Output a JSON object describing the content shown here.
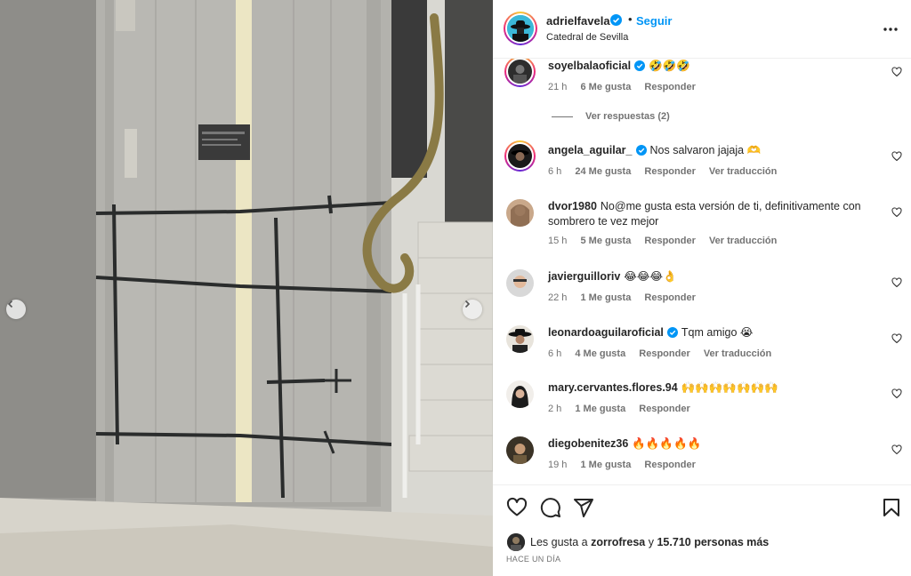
{
  "post": {
    "author": "adrielfavela",
    "follow_label": "Seguir",
    "dot": "•",
    "location": "Catedral de Sevilla",
    "more_icon": "more-horizontal-icon"
  },
  "comments": [
    {
      "user": "soyelbalaoficial",
      "verified": true,
      "text": "🤣🤣🤣",
      "time": "21 h",
      "likes": "6 Me gusta",
      "reply": "Responder",
      "translate": "",
      "view_replies": "Ver respuestas (2)"
    },
    {
      "user": "angela_aguilar_",
      "verified": true,
      "text": "Nos salvaron jajaja 🫶",
      "time": "6 h",
      "likes": "24 Me gusta",
      "reply": "Responder",
      "translate": "Ver traducción"
    },
    {
      "user": "dvor1980",
      "verified": false,
      "text": "No@me gusta esta versión de ti, definitivamente con sombrero te vez mejor",
      "time": "15 h",
      "likes": "5 Me gusta",
      "reply": "Responder",
      "translate": "Ver traducción"
    },
    {
      "user": "javierguilloriv",
      "verified": false,
      "text": "😂😂😂👌",
      "time": "22 h",
      "likes": "1 Me gusta",
      "reply": "Responder",
      "translate": ""
    },
    {
      "user": "leonardoaguilaroficial",
      "verified": true,
      "text": "Tqm amigo 😭",
      "time": "6 h",
      "likes": "4 Me gusta",
      "reply": "Responder",
      "translate": "Ver traducción"
    },
    {
      "user": "mary.cervantes.flores.94",
      "verified": false,
      "text": "🙌🙌🙌🙌🙌🙌🙌",
      "time": "2 h",
      "likes": "1 Me gusta",
      "reply": "Responder",
      "translate": ""
    },
    {
      "user": "diegobenitez36",
      "verified": false,
      "text": "🔥🔥🔥🔥🔥",
      "time": "19 h",
      "likes": "1 Me gusta",
      "reply": "Responder",
      "translate": ""
    }
  ],
  "actions": {
    "like_icon": "heart-icon",
    "comment_icon": "comment-icon",
    "share_icon": "send-icon",
    "save_icon": "bookmark-icon"
  },
  "likes": {
    "prefix": "Les gusta a",
    "friend": "zorrofresa",
    "connector": "y",
    "count": "15.710 personas más"
  },
  "posted_ago": "HACE UN DÍA",
  "colors": {
    "link_blue": "#0095f6",
    "text": "#262626",
    "secondary": "#737373"
  }
}
